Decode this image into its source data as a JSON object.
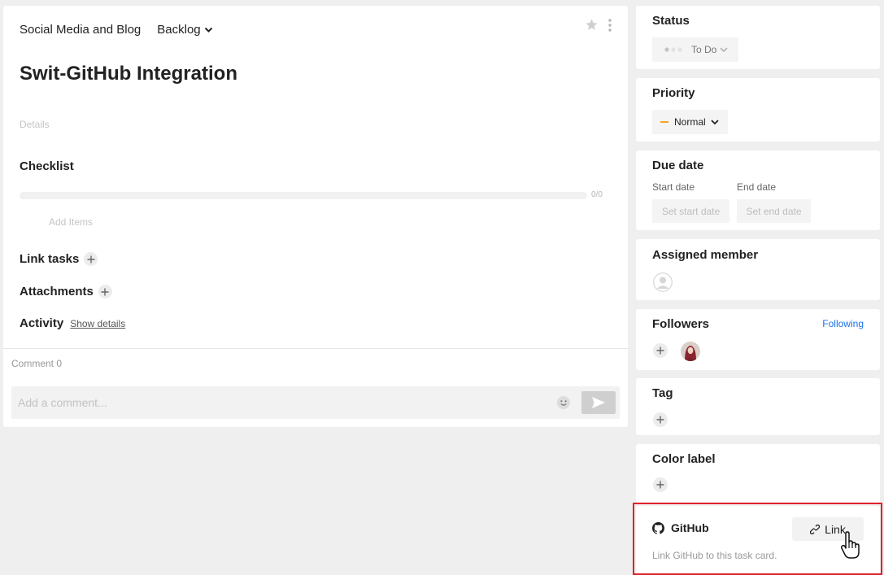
{
  "header": {
    "project": "Social Media and Blog",
    "list": "Backlog"
  },
  "task": {
    "title": "Swit-GitHub Integration",
    "details_placeholder": "Details"
  },
  "checklist": {
    "title": "Checklist",
    "progress_text": "0/0",
    "progress": 0,
    "add_items": "Add Items"
  },
  "sections": {
    "link_tasks": "Link tasks",
    "attachments": "Attachments",
    "activity": "Activity",
    "show_details": "Show details"
  },
  "comments": {
    "count_label": "Comment 0",
    "placeholder": "Add a comment..."
  },
  "status": {
    "title": "Status",
    "value": "To Do"
  },
  "priority": {
    "title": "Priority",
    "value": "Normal",
    "color": "#f5a623"
  },
  "due_date": {
    "title": "Due date",
    "start_label": "Start date",
    "end_label": "End date",
    "start_button": "Set start date",
    "end_button": "Set end date"
  },
  "assigned": {
    "title": "Assigned member"
  },
  "followers": {
    "title": "Followers",
    "following": "Following"
  },
  "tag": {
    "title": "Tag"
  },
  "color_label": {
    "title": "Color label"
  },
  "github": {
    "title": "GitHub",
    "link_label": "Link",
    "description": "Link GitHub to this task card."
  },
  "colors": {
    "accent_link": "#1a73e8",
    "highlight": "#e0212c"
  }
}
